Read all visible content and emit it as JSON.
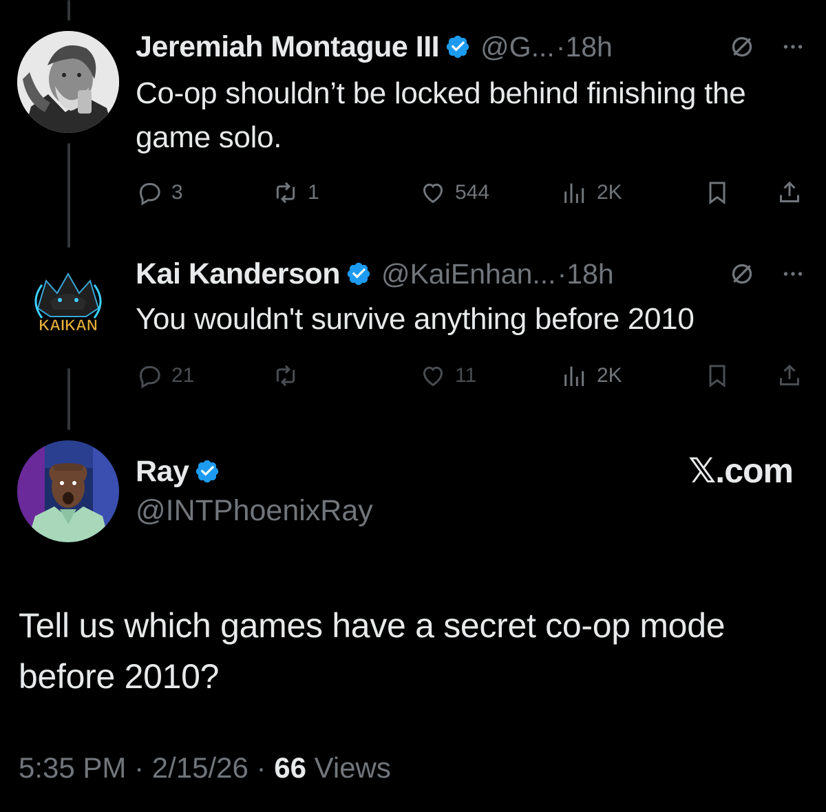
{
  "colors": {
    "background": "#000000",
    "text_primary": "#e7e9ea",
    "text_secondary": "#71767b",
    "verified_blue": "#1d9bf0",
    "thread_line": "#333639"
  },
  "replies": [
    {
      "display_name": "Jeremiah Montague III",
      "handle": "@G...",
      "time": "·18h",
      "text": "Co-op shouldn’t be locked behind finishing the game solo.",
      "replies_count": "3",
      "reposts_count": "1",
      "likes_count": "544",
      "views_count": "2K",
      "avatar_icon": "avatar-photo-bw"
    },
    {
      "display_name": "Kai Kanderson",
      "handle": "@KaiEnhan...",
      "time": "·18h",
      "text": "You wouldn't survive anything before 2010",
      "replies_count": "21",
      "reposts_count": "",
      "likes_count": "11",
      "views_count": "2K",
      "avatar_logo_text": "KAIKAN"
    }
  ],
  "main_tweet": {
    "display_name": "Ray",
    "handle": "@INTPhoenixRay",
    "watermark": "𝕏.com",
    "text": "Tell us which games have a secret co-op mode before 2010?",
    "time": "5:35 PM",
    "date": "2/15/26",
    "views_count": "66",
    "views_label": "Views",
    "separator": " · "
  }
}
